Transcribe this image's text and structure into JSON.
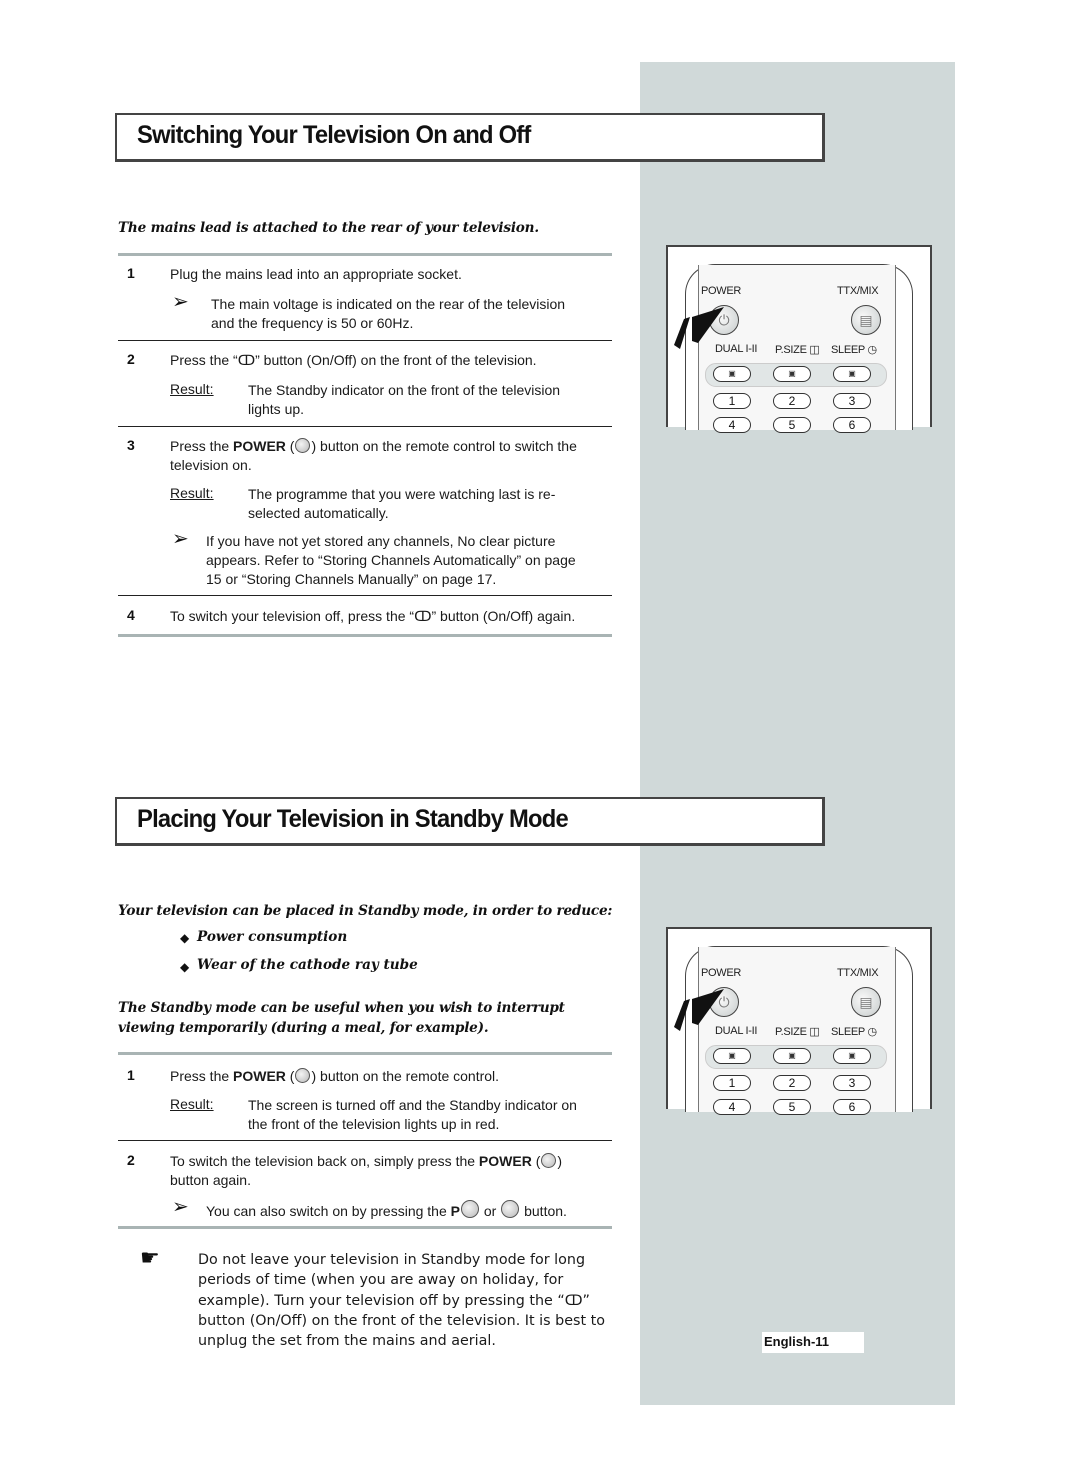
{
  "section1": {
    "title": "Switching Your Television On and Off",
    "intro": "The mains lead is attached to the rear of your television.",
    "steps": [
      {
        "num": "1",
        "text": "Plug the mains lead into an appropriate socket.",
        "note_lines": [
          "The main voltage is indicated on the rear of the television",
          "and the frequency is 50 or 60Hz."
        ]
      },
      {
        "num": "2",
        "text": "Press the “ↀ” button (On/Off) on the front of the television.",
        "result_label": "Result:",
        "result_lines": [
          "The Standby indicator on the front of the television",
          "lights up."
        ]
      },
      {
        "num": "3",
        "text_pre": "Press the ",
        "text_bold": "POWER",
        "text_post": " button on the remote control to switch the",
        "text_line2": "television on.",
        "result_label": "Result:",
        "result_lines": [
          "The programme that you were watching last is re-",
          "selected automatically."
        ],
        "note_lines": [
          "If you have not yet stored any channels, No clear picture",
          "appears. Refer to “Storing Channels Automatically” on page",
          "15 or “Storing Channels Manually” on page 17."
        ]
      },
      {
        "num": "4",
        "text": "To switch your television off, press the “ↀ” button (On/Off) again."
      }
    ]
  },
  "section2": {
    "title": "Placing Your Television in Standby Mode",
    "intro": "Your television can be placed in Standby mode, in order to reduce:",
    "bullets": [
      "Power consumption",
      "Wear of the cathode ray tube"
    ],
    "intro2_lines": [
      "The Standby mode can be useful when you wish to interrupt",
      "viewing temporarily (during a meal, for example)."
    ],
    "steps": [
      {
        "num": "1",
        "text_pre": "Press the ",
        "text_bold": "POWER",
        "text_post": " button on the remote control.",
        "result_label": "Result:",
        "result_lines": [
          "The screen is turned off and the Standby indicator on",
          "the front of the television lights up in red."
        ]
      },
      {
        "num": "2",
        "text_pre": "To switch the television back on, simply press the ",
        "text_bold": "POWER",
        "text_post": "",
        "text_line2": "button again.",
        "note_pre": "You can also switch on by pressing the ",
        "note_bold": "P",
        "note_mid": " or ",
        "note_post": " button."
      }
    ],
    "caution_lines": [
      "Do not leave your television in Standby mode for long",
      "periods of time (when you are away on holiday, for",
      "example). Turn your television off by pressing the “ↀ”",
      "button (On/Off) on the front of the television. It is best to",
      "unplug the set from the mains and aerial."
    ]
  },
  "remote": {
    "power_label": "POWER",
    "ttx_label": "TTX/MIX",
    "dual_label": "DUAL I-II",
    "psize_label": "P.SIZE",
    "sleep_label": "SLEEP",
    "numbers": [
      "1",
      "2",
      "3",
      "4",
      "5",
      "6"
    ]
  },
  "footer": {
    "page_label": "English-11"
  },
  "colors": {
    "side_panel": "#d0d9d9",
    "rule": "#a9b4b4"
  }
}
